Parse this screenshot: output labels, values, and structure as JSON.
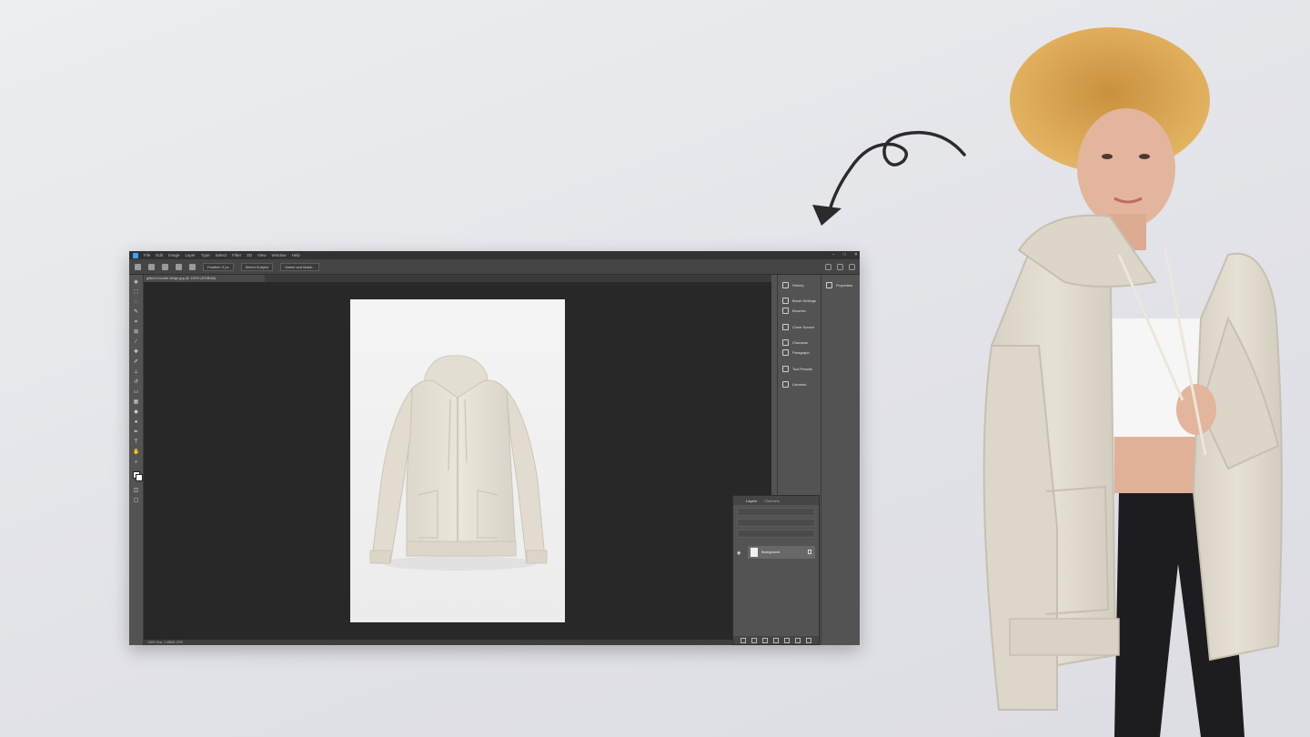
{
  "photoshop": {
    "menu": [
      "File",
      "Edit",
      "Image",
      "Layer",
      "Type",
      "Select",
      "Filter",
      "3D",
      "View",
      "Window",
      "Help"
    ],
    "window_buttons": [
      "–",
      "□",
      "✕"
    ],
    "options": {
      "feather_label": "Feather: 0 px",
      "select_subject": "Select Subject",
      "select_mask": "Select and Mask..."
    },
    "document_tab": "gilbert-hoodie-beige.jpg @ 100% (RGB/8#)",
    "status_text": "100%    Doc: 1.46M/1.47M",
    "right_panels": [
      "History",
      "Brush Settings",
      "Brushes",
      "Clone Source",
      "Character",
      "Paragraph",
      "Tool Presets",
      "Libraries"
    ],
    "properties_label": "Properties",
    "layers_panel": {
      "tabs": [
        "Layers",
        "Channels"
      ],
      "layer_name": "Background"
    },
    "colors": {
      "accent": "#31a8ff",
      "panel": "#535353",
      "canvas": "#282828"
    }
  }
}
